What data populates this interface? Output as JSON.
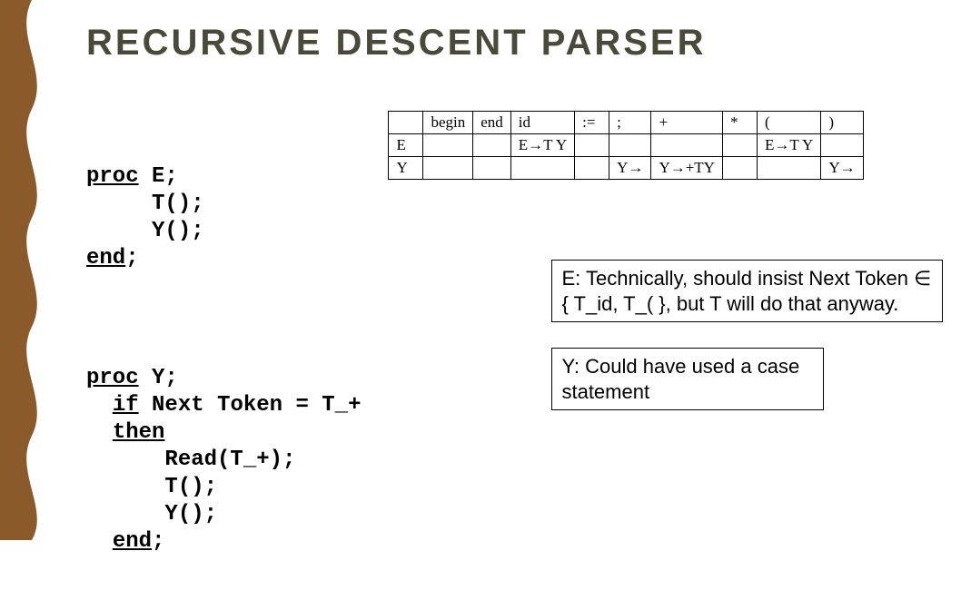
{
  "title": "RECURSIVE DESCENT PARSER",
  "code": {
    "procE": {
      "l1a": "proc",
      "l1b": " E;",
      "l2": "     T();",
      "l3": "     Y();",
      "l4a": "end",
      "l4b": ";"
    },
    "procY": {
      "l1a": "proc",
      "l1b": " Y;",
      "l2a": "  ",
      "l2b": "if",
      "l2c": " Next Token = T_+",
      "l3a": "  ",
      "l3b": "then",
      "l4": "      Read(T_+);",
      "l5": "      T();",
      "l6": "      Y();",
      "l7a": "  ",
      "l7b": "end",
      "l7c": ";"
    }
  },
  "chart_data": {
    "type": "table",
    "title": "Parse table",
    "columns": [
      "",
      "begin",
      "end",
      "id",
      ":=",
      ";",
      "+",
      "*",
      "(",
      ")"
    ],
    "rows": [
      {
        "name": "E",
        "cells": [
          "",
          "",
          "E→T Y",
          "",
          "",
          "",
          "",
          "E→T Y",
          ""
        ]
      },
      {
        "name": "Y",
        "cells": [
          "",
          "",
          "",
          "",
          "Y→",
          "Y→+TY",
          "",
          "",
          "Y→"
        ]
      }
    ]
  },
  "notes": {
    "e": "E:  Technically, should insist Next Token ∈ { T_id, T_( }, but T will do that anyway.",
    "y": "Y: Could have used a case statement"
  }
}
